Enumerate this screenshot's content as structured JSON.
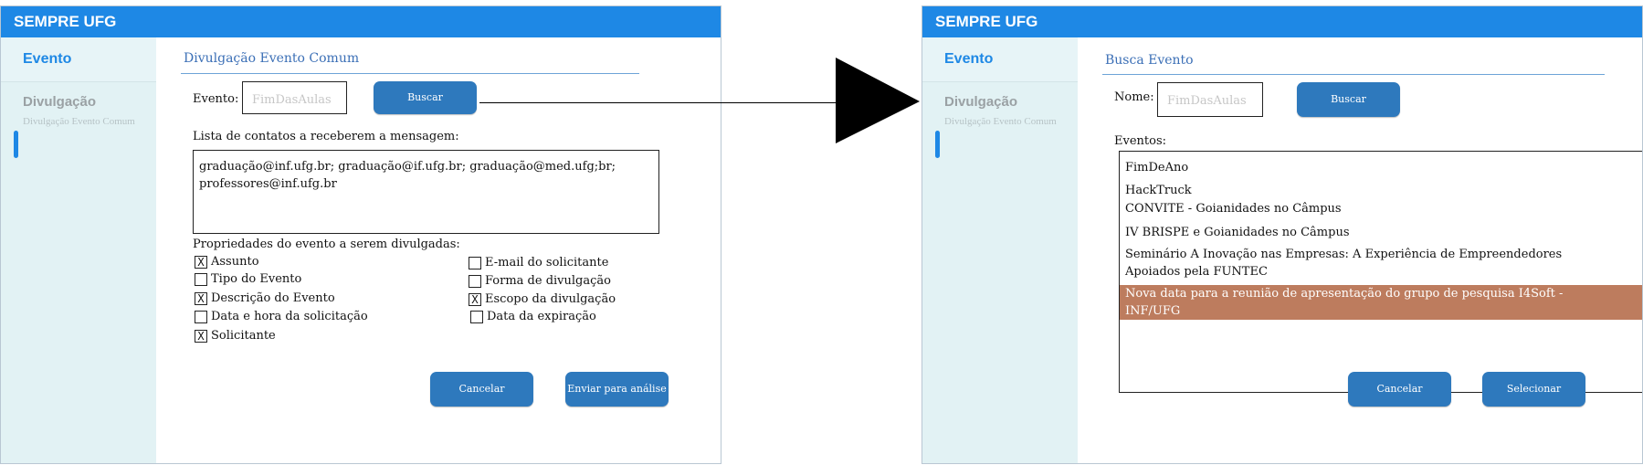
{
  "left": {
    "app_title": "SEMPRE UFG",
    "sidebar": {
      "active": "Evento",
      "group": "Divulgação",
      "sub": "Divulgação Evento Comum"
    },
    "page_title": "Divulgação Evento Comum",
    "event_label": "Evento:",
    "event_placeholder": "FimDasAulas",
    "search_label": "Buscar",
    "contacts_label": "Lista de contatos a receberem a mensagem:",
    "contacts_line1": "graduação@inf.ufg.br; graduação@if.ufg.br; graduação@med.ufg;br;",
    "contacts_line2": "professores@inf.ufg.br",
    "props_label": "Propriedades do evento a serem divulgadas:",
    "props": [
      {
        "label": "Assunto",
        "mark": "X"
      },
      {
        "label": "Tipo do Evento",
        "mark": ""
      },
      {
        "label": "Descrição do Evento",
        "mark": "X"
      },
      {
        "label": "Data e hora da solicitação",
        "mark": ""
      },
      {
        "label": "Solicitante",
        "mark": "X"
      },
      {
        "label": "E-mail do solicitante",
        "mark": ""
      },
      {
        "label": "Forma de divulgação",
        "mark": ""
      },
      {
        "label": "Escopo da divulgação",
        "mark": "X"
      },
      {
        "label": "Data da expiração",
        "mark": ""
      }
    ],
    "cancel_label": "Cancelar",
    "submit_label": "Enviar para análise"
  },
  "right": {
    "app_title": "SEMPRE UFG",
    "sidebar": {
      "active": "Evento",
      "group": "Divulgação",
      "sub": "Divulgação Evento Comum"
    },
    "page_title": "Busca Evento",
    "name_label": "Nome:",
    "name_placeholder": "FimDasAulas",
    "search_label": "Buscar",
    "events_label": "Eventos:",
    "events": [
      "FimDeAno",
      "HackTruck",
      "CONVITE - Goianidades no Câmpus",
      "IV BRISPE e Goianidades no Câmpus",
      "Seminário A Inovação nas Empresas: A Experiência de Empreendedores",
      "Apoiados pela FUNTEC",
      "Nova data para a reunião de apresentação do grupo de pesquisa I4Soft -",
      "INF/UFG"
    ],
    "cancel_label": "Cancelar",
    "select_label": "Selecionar"
  },
  "colors": {
    "titlebar": "#1e88e5",
    "sidebar": "#e2f2f4",
    "button": "#2e79bd",
    "selection": "#bd7c5e"
  }
}
